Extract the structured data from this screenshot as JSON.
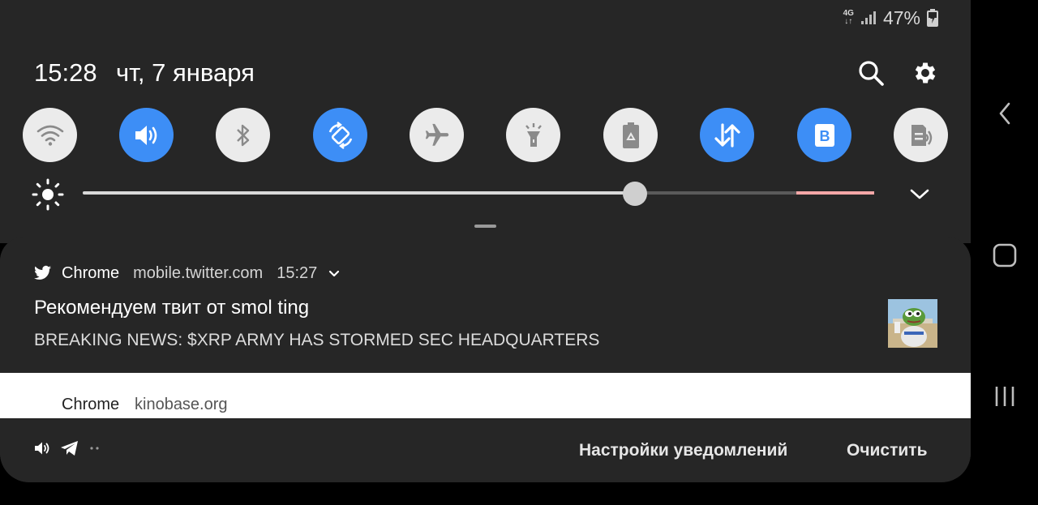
{
  "status_bar": {
    "network_top": "4G",
    "network_bottom": "↓↑",
    "battery_percent": "47%",
    "signal_icon": "signal-icon",
    "battery_icon": "battery-charging-icon"
  },
  "header": {
    "time": "15:28",
    "date": "чт, 7 января",
    "search_icon": "search-icon",
    "settings_icon": "gear-icon"
  },
  "quick_toggles": [
    {
      "name": "wifi",
      "icon": "wifi-icon",
      "state": "off"
    },
    {
      "name": "sound",
      "icon": "volume-icon",
      "state": "on"
    },
    {
      "name": "bluetooth",
      "icon": "bluetooth-icon",
      "state": "off"
    },
    {
      "name": "auto-rotate",
      "icon": "rotate-icon",
      "state": "on"
    },
    {
      "name": "airplane",
      "icon": "airplane-icon",
      "state": "off"
    },
    {
      "name": "flashlight",
      "icon": "flashlight-icon",
      "state": "off"
    },
    {
      "name": "power-saving",
      "icon": "battery-saver-icon",
      "state": "off"
    },
    {
      "name": "mobile-data",
      "icon": "data-transfer-icon",
      "state": "on"
    },
    {
      "name": "bixby",
      "icon": "bixby-icon",
      "state": "on"
    },
    {
      "name": "nfc",
      "icon": "nfc-icon",
      "state": "off"
    }
  ],
  "brightness": {
    "level": 0.698,
    "icon": "sun-icon",
    "expand_icon": "chevron-down-icon"
  },
  "notifications": [
    {
      "app": "Chrome",
      "app_icon": "twitter-bird-icon",
      "source": "mobile.twitter.com",
      "time": "15:27",
      "title": "Рекомендуем твит от smol ting",
      "text": "BREAKING NEWS: $XRP ARMY HAS STORMED SEC HEADQUARTERS"
    },
    {
      "app": "Chrome",
      "source": "kinobase.org"
    }
  ],
  "footer": {
    "notification_settings": "Настройки уведомлений",
    "clear": "Очистить",
    "icons": [
      "volume-icon",
      "telegram-icon",
      "more-dots-icon"
    ]
  },
  "nav_bar": {
    "back": "back-icon",
    "home": "home-icon",
    "recents": "recents-icon"
  },
  "colors": {
    "panel": "#262626",
    "toggle_on": "#3d8ef6",
    "toggle_off": "#ebebeb"
  }
}
